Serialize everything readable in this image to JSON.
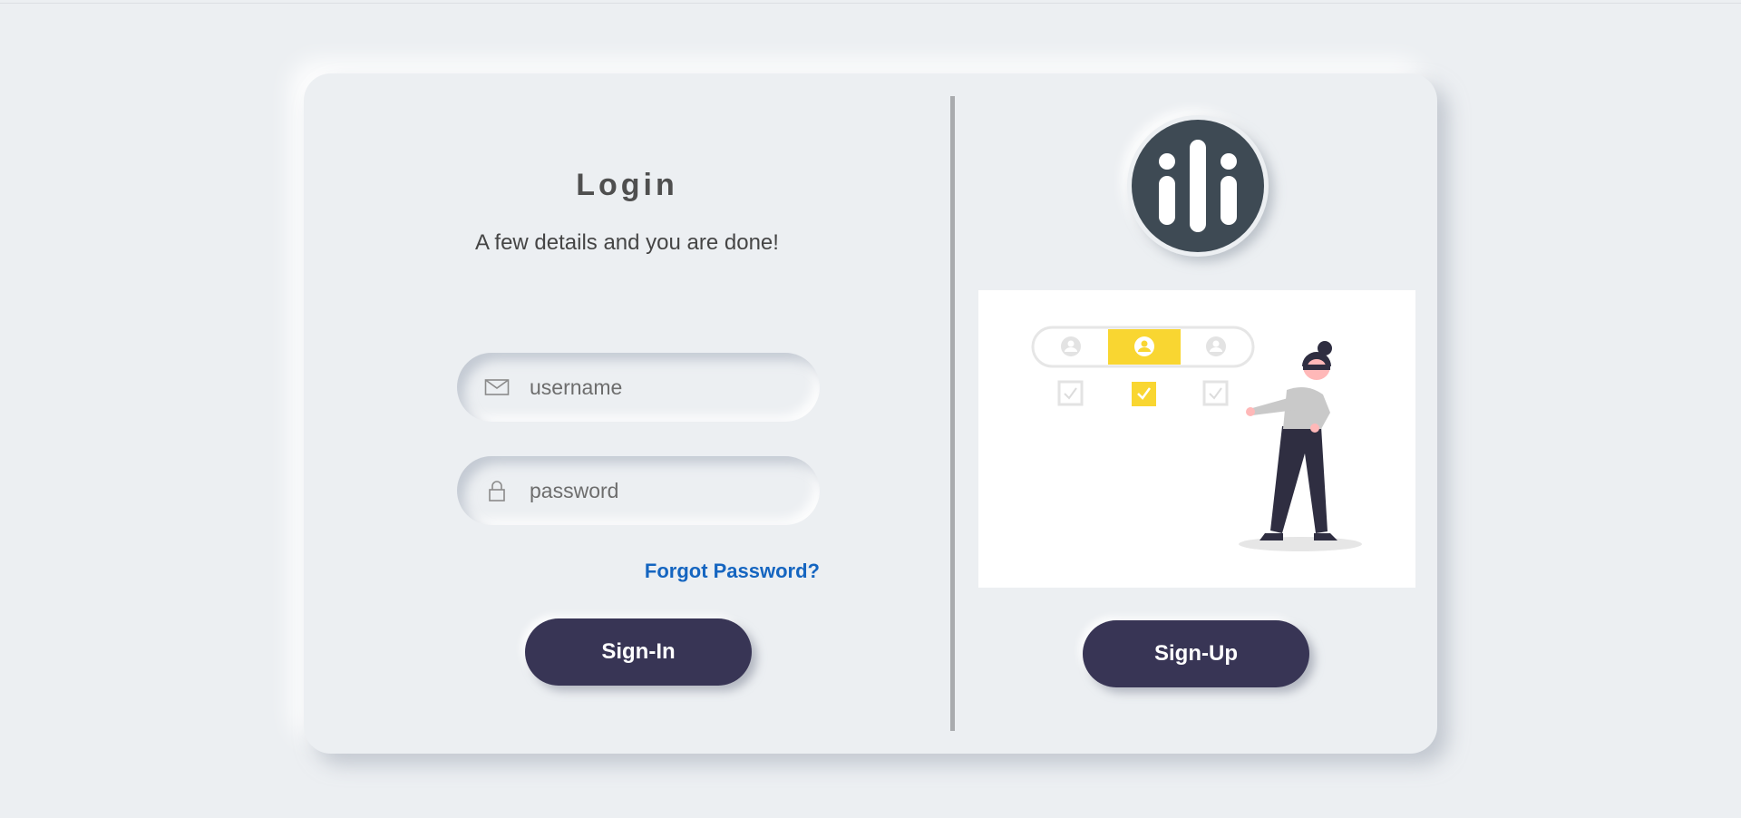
{
  "login": {
    "title": "Login",
    "subtitle": "A few details and you are done!",
    "username_placeholder": "username",
    "password_placeholder": "password",
    "forgot_label": "Forgot Password?",
    "signin_label": "Sign-In"
  },
  "signup": {
    "signup_label": "Sign-Up"
  },
  "icons": {
    "username": "envelope-icon",
    "password": "lock-icon",
    "logo": "ili-logo"
  },
  "colors": {
    "background": "#eceff2",
    "button": "#383555",
    "link": "#1565c0",
    "logo": "#3e4a54",
    "accent_yellow": "#f9d631"
  }
}
